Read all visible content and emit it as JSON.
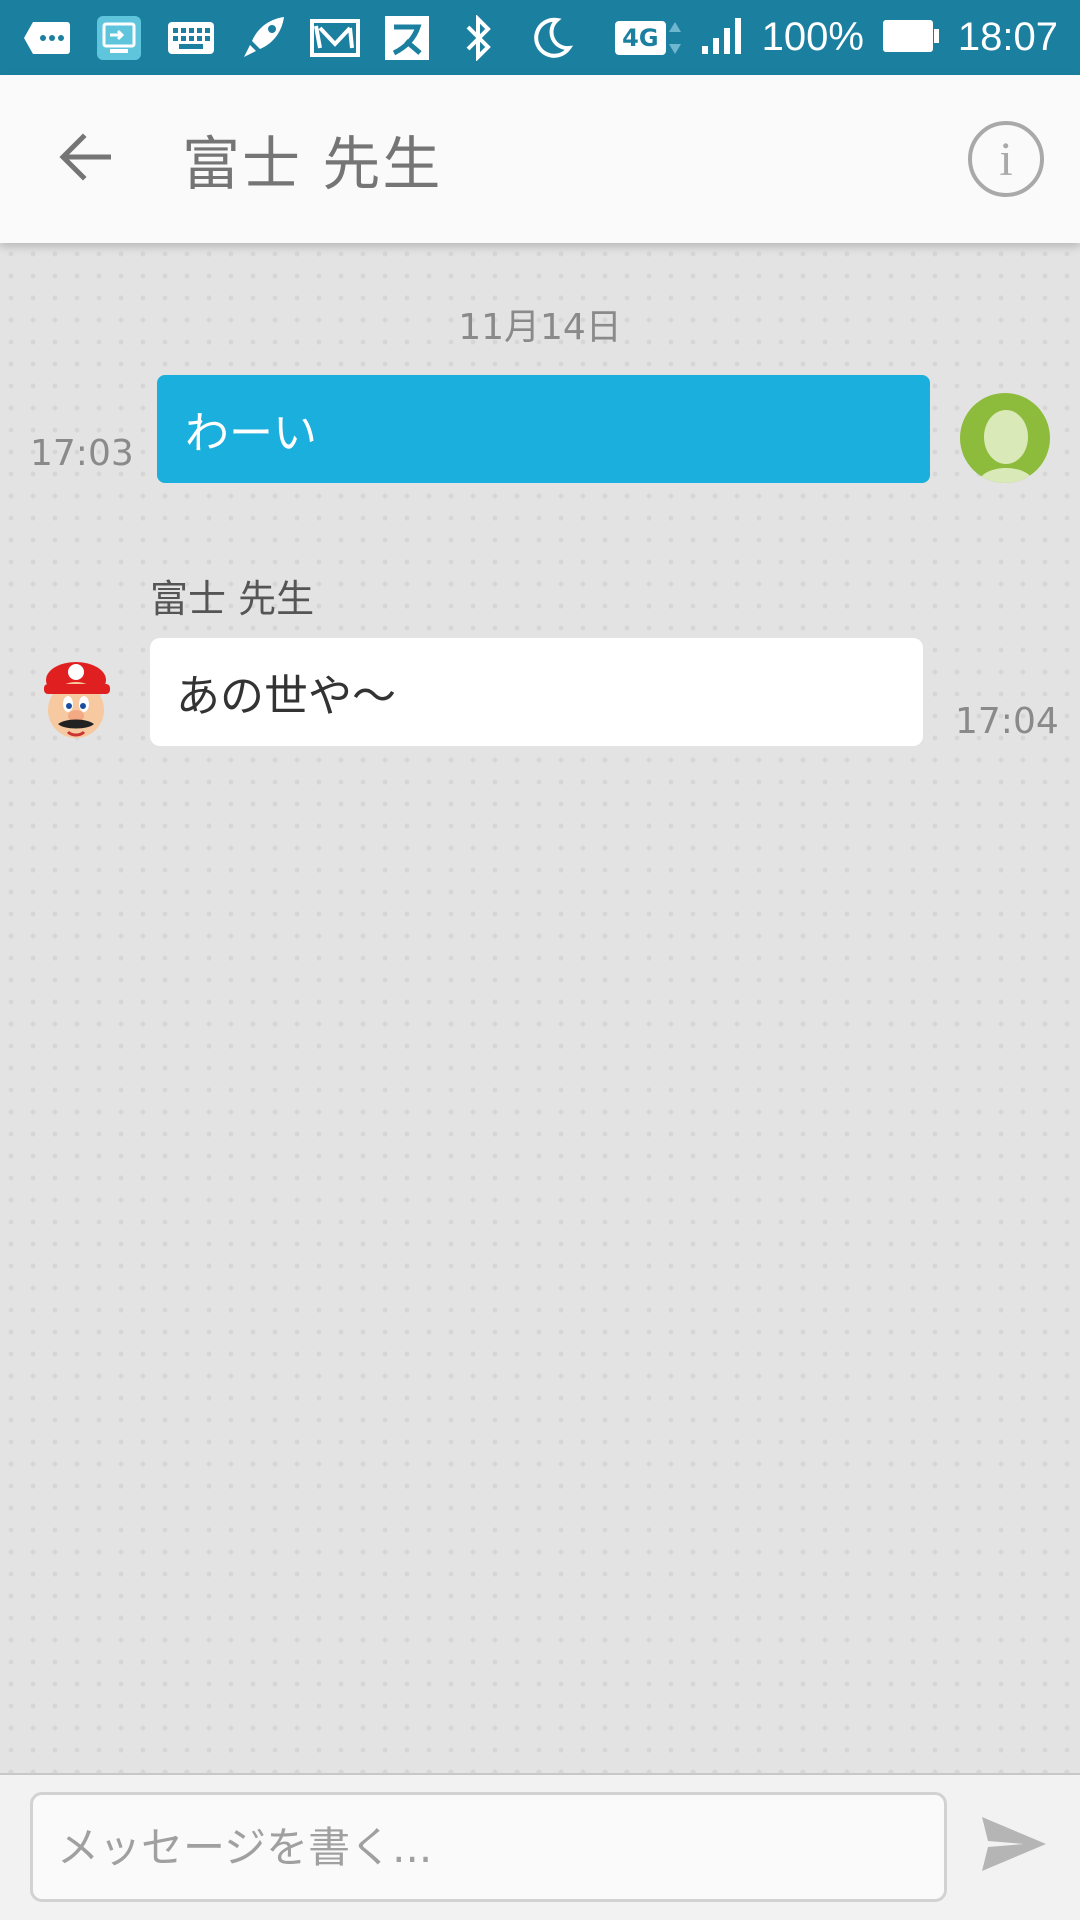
{
  "status_bar": {
    "battery_percent_label": "100%",
    "time": "18:07",
    "network_label": "4G",
    "icons": [
      "more-icon",
      "cast-icon",
      "keyboard-icon",
      "rocket-icon",
      "mail-icon",
      "app-su-icon",
      "bluetooth-icon",
      "moon-icon",
      "network-4g-icon",
      "signal-icon",
      "battery-icon"
    ],
    "colors": {
      "background": "#1b7fa0"
    }
  },
  "header": {
    "title": "富士 先生",
    "back_icon": "arrow-left-icon",
    "info_icon": "info-icon",
    "info_glyph": "i"
  },
  "chat": {
    "date_label": "11月14日",
    "messages": [
      {
        "direction": "outgoing",
        "text": "わーい",
        "time": "17:03",
        "color": "#1aafdc"
      },
      {
        "direction": "incoming",
        "sender": "富士 先生",
        "text": "あの世や〜",
        "time": "17:04",
        "color": "#ffffff"
      }
    ]
  },
  "composer": {
    "placeholder": "メッセージを書く...",
    "send_icon": "send-icon"
  }
}
